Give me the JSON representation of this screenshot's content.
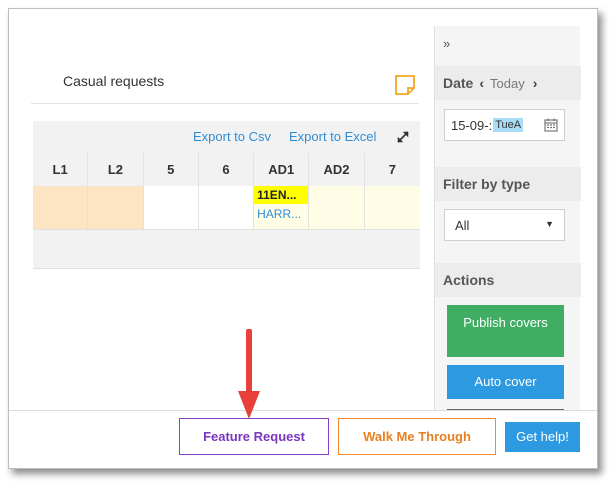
{
  "card": {
    "title": "Casual requests"
  },
  "toolbar": {
    "export_csv": "Export to Csv",
    "export_excel": "Export to Excel"
  },
  "grid": {
    "headers": [
      "L1",
      "L2",
      "5",
      "6",
      "AD1",
      "AD2",
      "7"
    ],
    "lesson": {
      "code": "11EN...",
      "teacher": "HARR..."
    }
  },
  "panel": {
    "collapse": "»",
    "date_label": "Date",
    "prev": "‹",
    "today": "Today",
    "next": "›",
    "date_value": "15-09-:",
    "date_highlight": "TueA",
    "filter_label": "Filter by type",
    "filter_value": "All",
    "actions_label": "Actions",
    "publish_label": "Publish covers",
    "auto_cover_label": "Auto cover"
  },
  "footer": {
    "feature_request": "Feature Request",
    "walk_me_through": "Walk Me Through",
    "get_help": "Get help!"
  },
  "colors": {
    "accent_blue": "#2d99e0",
    "publish_green": "#3fae62",
    "feature_purple": "#7a36c0",
    "walk_orange": "#e8801f",
    "note_yellow": "#f5a623",
    "lesson_yellow": "#ffff00",
    "arrow_red": "#e8403a"
  }
}
